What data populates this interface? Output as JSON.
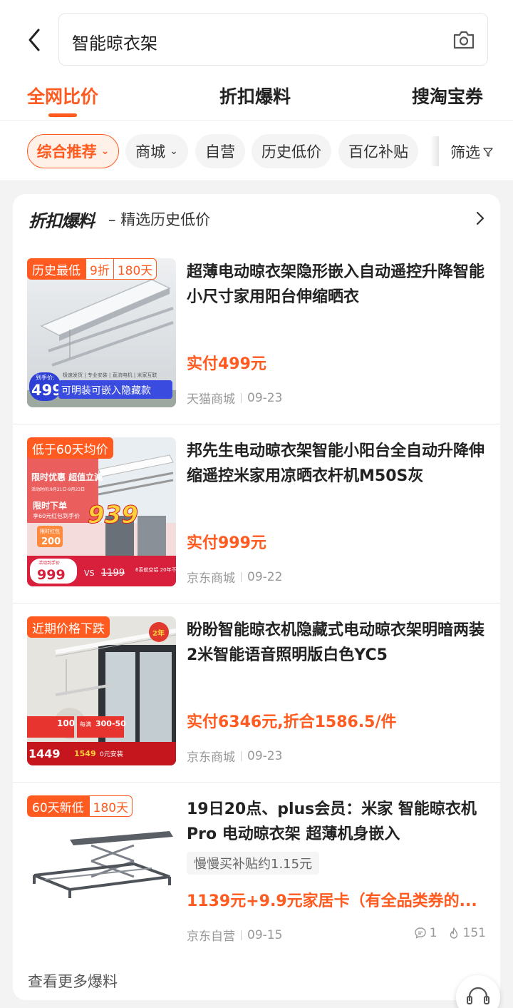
{
  "search": {
    "query": "智能晾衣架"
  },
  "tabs": [
    {
      "label": "全网比价",
      "active": true
    },
    {
      "label": "折扣爆料",
      "active": false
    },
    {
      "label": "搜淘宝券",
      "active": false
    }
  ],
  "filters": {
    "chips": [
      "综合推荐",
      "商城",
      "自营",
      "历史低价",
      "百亿补贴"
    ],
    "filter_label": "筛选"
  },
  "section": {
    "brand": "折扣爆料",
    "subtitle": "精选历史低价",
    "more_label": "查看更多爆料"
  },
  "items": [
    {
      "tag": "历史最低",
      "tag_discount": "9折",
      "tag_days": "180天",
      "title": "超薄电动晾衣架隐形嵌入自动遥控升降智能小尺寸家用阳台伸缩晒衣",
      "price": "实付499元",
      "store": "天猫商城",
      "date": "09-23",
      "image": {
        "feature_line": "极速发货 | 专业安装 | 直流电机 | 米家互联",
        "badge_label": "到手价:",
        "badge_price": "499",
        "badge_text": "可明装可嵌入隐藏款"
      }
    },
    {
      "tag": "低于60天均价",
      "title": "邦先生电动晾衣架智能小阳台全自动升降伸缩遥控米家用凉晒衣杆机M50S灰",
      "price": "实付999元",
      "store": "京东商城",
      "date": "09-22",
      "image": {
        "promo_title": "限时优惠 超值立減",
        "promo_date": "活动时间:9月21日-9月23日",
        "promo_line1": "限时下单",
        "promo_line2": "享60元红包到手价",
        "big_price": "939",
        "red_pack_label": "限时红包",
        "red_pack_value": "200",
        "final_label": "活动到手价",
        "final_price": "999",
        "compare_price": "1199",
        "compare_vs": "VS",
        "badge_text": "6系航空铝 20年不生锈"
      }
    },
    {
      "tag": "近期价格下跌",
      "title": "盼盼智能晾衣机隐藏式电动晾衣架明暗两装2米智能语音照明版白色YC5",
      "price": "实付6346元,折合1586.5/件",
      "store": "京东商城",
      "date": "09-23",
      "image": {
        "corner_text": "2年",
        "coupon_value": "100",
        "coupon_range": "300-50",
        "coupon_label": "每满",
        "price_a": "1449",
        "price_b": "1549",
        "install": "0元安装"
      }
    },
    {
      "tag": "60天新低",
      "tag_days": "180天",
      "title": "19日20点、plus会员：米家 智能晾衣机Pro 电动晾衣架 超薄机身嵌入",
      "subsidy": "慢慢买补贴约1.15元",
      "price": "1139元+9.9元家居卡（有全品类券的...",
      "store": "京东自营",
      "date": "09-15",
      "comments": "1",
      "heat": "151"
    }
  ],
  "colors": {
    "accent": "#ff5a1f",
    "tag_bg": "#ff5a1f",
    "price": "#ff5a1f",
    "badge_blue": "#2e3fd6"
  }
}
